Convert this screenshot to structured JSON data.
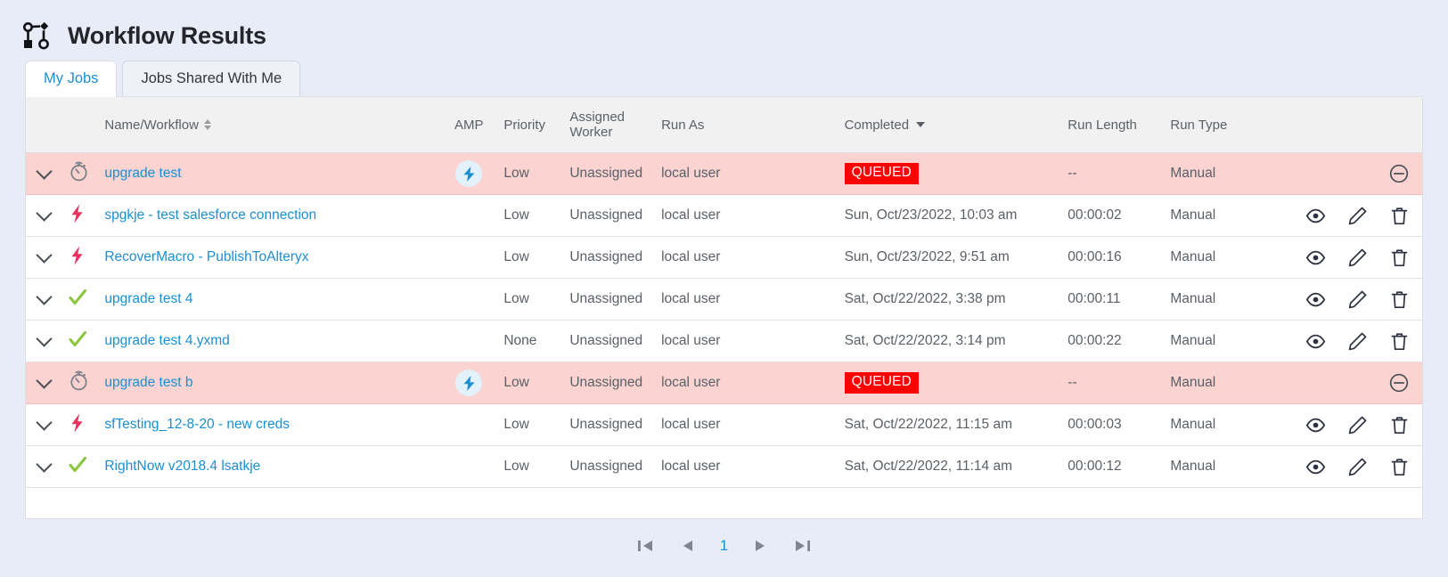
{
  "header": {
    "title": "Workflow Results",
    "icon": "workflow-nodes-icon"
  },
  "tabs": [
    {
      "label": "My Jobs",
      "active": true
    },
    {
      "label": "Jobs Shared With Me",
      "active": false
    }
  ],
  "table": {
    "columns": [
      {
        "key": "expand",
        "label": ""
      },
      {
        "key": "status",
        "label": ""
      },
      {
        "key": "name",
        "label": "Name/Workflow",
        "sort": "both"
      },
      {
        "key": "amp",
        "label": "AMP"
      },
      {
        "key": "priority",
        "label": "Priority"
      },
      {
        "key": "worker",
        "label": "Assigned Worker"
      },
      {
        "key": "runas",
        "label": "Run As"
      },
      {
        "key": "completed",
        "label": "Completed",
        "sort": "desc"
      },
      {
        "key": "runlength",
        "label": "Run Length"
      },
      {
        "key": "runtype",
        "label": "Run Type"
      },
      {
        "key": "actions",
        "label": ""
      }
    ],
    "rows": [
      {
        "status_icon": "stopwatch-icon",
        "name": "upgrade test",
        "amp": true,
        "priority": "Low",
        "worker": "Unassigned",
        "runas": "local user",
        "completed": "QUEUED",
        "completed_is_badge": true,
        "runlength": "--",
        "runtype": "Manual",
        "alert": true,
        "actions": [
          "cancel-icon"
        ]
      },
      {
        "status_icon": "error-bolt-icon",
        "name": "spgkje - test salesforce connection",
        "amp": false,
        "priority": "Low",
        "worker": "Unassigned",
        "runas": "local user",
        "completed": "Sun, Oct/23/2022, 10:03 am",
        "completed_is_badge": false,
        "runlength": "00:00:02",
        "runtype": "Manual",
        "alert": false,
        "actions": [
          "eye-icon",
          "pencil-icon",
          "trash-icon"
        ]
      },
      {
        "status_icon": "error-bolt-icon",
        "name": "RecoverMacro - PublishToAlteryx",
        "amp": false,
        "priority": "Low",
        "worker": "Unassigned",
        "runas": "local user",
        "completed": "Sun, Oct/23/2022, 9:51 am",
        "completed_is_badge": false,
        "runlength": "00:00:16",
        "runtype": "Manual",
        "alert": false,
        "actions": [
          "eye-icon",
          "pencil-icon",
          "trash-icon"
        ]
      },
      {
        "status_icon": "success-check-icon",
        "name": "upgrade test 4",
        "amp": false,
        "priority": "Low",
        "worker": "Unassigned",
        "runas": "local user",
        "completed": "Sat, Oct/22/2022, 3:38 pm",
        "completed_is_badge": false,
        "runlength": "00:00:11",
        "runtype": "Manual",
        "alert": false,
        "actions": [
          "eye-icon",
          "pencil-icon",
          "trash-icon"
        ]
      },
      {
        "status_icon": "success-check-icon",
        "name": "upgrade test 4.yxmd",
        "amp": false,
        "priority": "None",
        "worker": "Unassigned",
        "runas": "local user",
        "completed": "Sat, Oct/22/2022, 3:14 pm",
        "completed_is_badge": false,
        "runlength": "00:00:22",
        "runtype": "Manual",
        "alert": false,
        "actions": [
          "eye-icon",
          "pencil-icon",
          "trash-icon"
        ]
      },
      {
        "status_icon": "stopwatch-icon",
        "name": "upgrade test b",
        "amp": true,
        "priority": "Low",
        "worker": "Unassigned",
        "runas": "local user",
        "completed": "QUEUED",
        "completed_is_badge": true,
        "runlength": "--",
        "runtype": "Manual",
        "alert": true,
        "actions": [
          "cancel-icon"
        ]
      },
      {
        "status_icon": "error-bolt-icon",
        "name": "sfTesting_12-8-20 - new creds",
        "amp": false,
        "priority": "Low",
        "worker": "Unassigned",
        "runas": "local user",
        "completed": "Sat, Oct/22/2022, 11:15 am",
        "completed_is_badge": false,
        "runlength": "00:00:03",
        "runtype": "Manual",
        "alert": false,
        "actions": [
          "eye-icon",
          "pencil-icon",
          "trash-icon"
        ]
      },
      {
        "status_icon": "success-check-icon",
        "name": "RightNow v2018.4 lsatkje",
        "amp": false,
        "priority": "Low",
        "worker": "Unassigned",
        "runas": "local user",
        "completed": "Sat, Oct/22/2022, 11:14 am",
        "completed_is_badge": false,
        "runlength": "00:00:12",
        "runtype": "Manual",
        "alert": false,
        "actions": [
          "eye-icon",
          "pencil-icon",
          "trash-icon"
        ]
      }
    ]
  },
  "pagination": {
    "first_icon": "first-page-icon",
    "prev_icon": "prev-page-icon",
    "current_page": "1",
    "next_icon": "next-page-icon",
    "last_icon": "last-page-icon"
  },
  "colors": {
    "page_background": "#e8ecf7",
    "alert_row": "#fbd3d0",
    "queued_badge": "#ff0000",
    "link": "#1a8fd1",
    "amp_icon": "#1a8fd1",
    "success_check": "#8cc63f",
    "error_bolt": "#e8315f",
    "header_row": "#f1f1f1"
  }
}
